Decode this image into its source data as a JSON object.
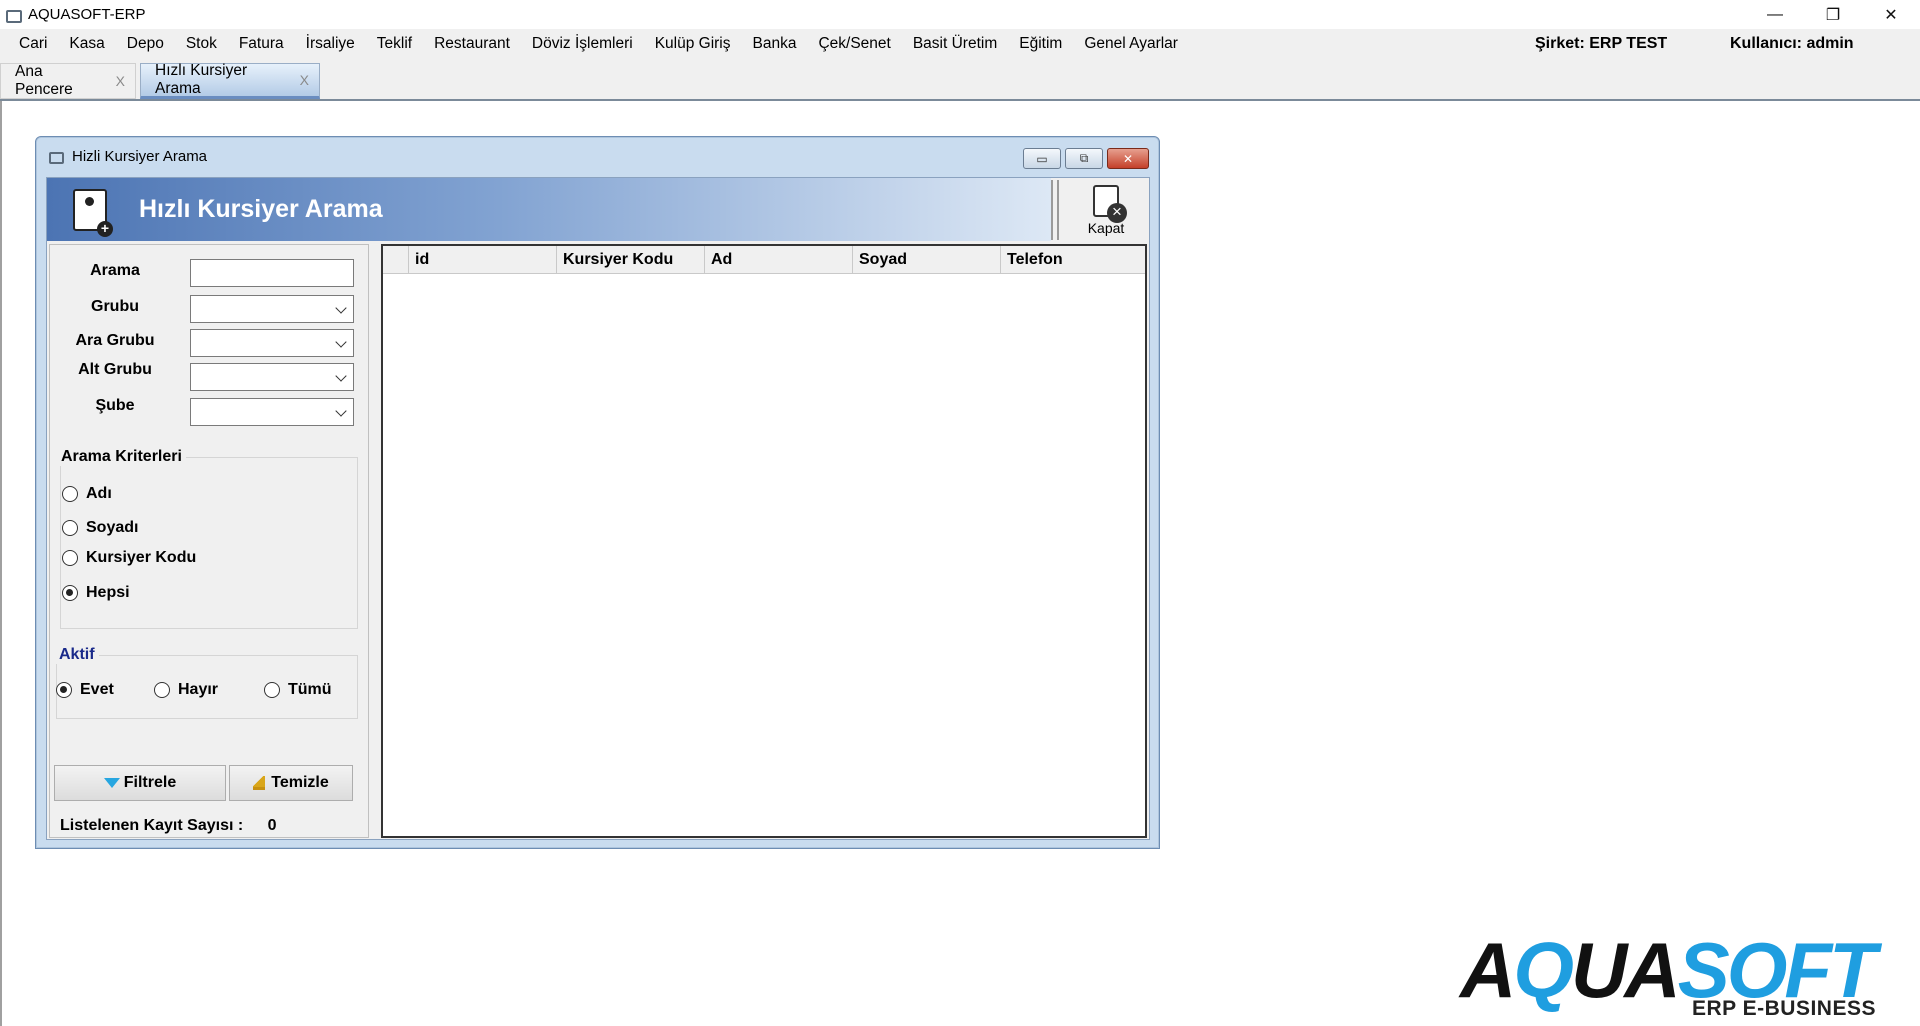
{
  "app": {
    "title": "AQUASOFT-ERP"
  },
  "window_controls": {
    "minimize": "—",
    "restore": "❐",
    "close": "✕"
  },
  "menu": {
    "items": [
      "Cari",
      "Kasa",
      "Depo",
      "Stok",
      "Fatura",
      "İrsaliye",
      "Teklif",
      "Restaurant",
      "Döviz İşlemleri",
      "Kulüp Giriş",
      "Banka",
      "Çek/Senet",
      "Basit Üretim",
      "Eğitim",
      "Genel Ayarlar"
    ],
    "company": "Şirket: ERP TEST",
    "user": "Kullanıcı: admin"
  },
  "tabs": [
    {
      "label": "Ana Pencere",
      "close": "X"
    },
    {
      "label": "Hızlı Kursiyer Arama",
      "close": "X"
    }
  ],
  "subwindow": {
    "title": "Hizli Kursiyer Arama",
    "banner_title": "Hızlı Kursiyer Arama",
    "close_tool_label": "Kapat",
    "btn_min": "▭",
    "btn_max": "⧉",
    "btn_close": "✕"
  },
  "filters": {
    "arama_label": "Arama",
    "arama_value": "",
    "grubu_label": "Grubu",
    "ara_grubu_label": "Ara Grubu",
    "alt_grubu_label": "Alt Grubu",
    "sube_label": "Şube"
  },
  "criteria": {
    "title": "Arama Kriterleri",
    "options": [
      "Adı",
      "Soyadı",
      "Kursiyer Kodu",
      "Hepsi"
    ],
    "selected": "Hepsi"
  },
  "active": {
    "title": "Aktif",
    "options": [
      "Evet",
      "Hayır",
      "Tümü"
    ],
    "selected": "Evet",
    "title_color": "#1a2a8a"
  },
  "buttons": {
    "filter": "Filtrele",
    "clear": "Temizle"
  },
  "count": {
    "label": "Listelenen Kayıt Sayısı :",
    "value": "0"
  },
  "grid": {
    "columns": [
      "id",
      "Kursiyer Kodu",
      "Ad",
      "Soyad",
      "Telefon"
    ],
    "rows": []
  },
  "logo": {
    "part1": "AQUA",
    "part1a": "Q",
    "part2": "SOFT",
    "sub": "ERP E-BUSINESS",
    "accent_color": "#1f9ee0"
  }
}
